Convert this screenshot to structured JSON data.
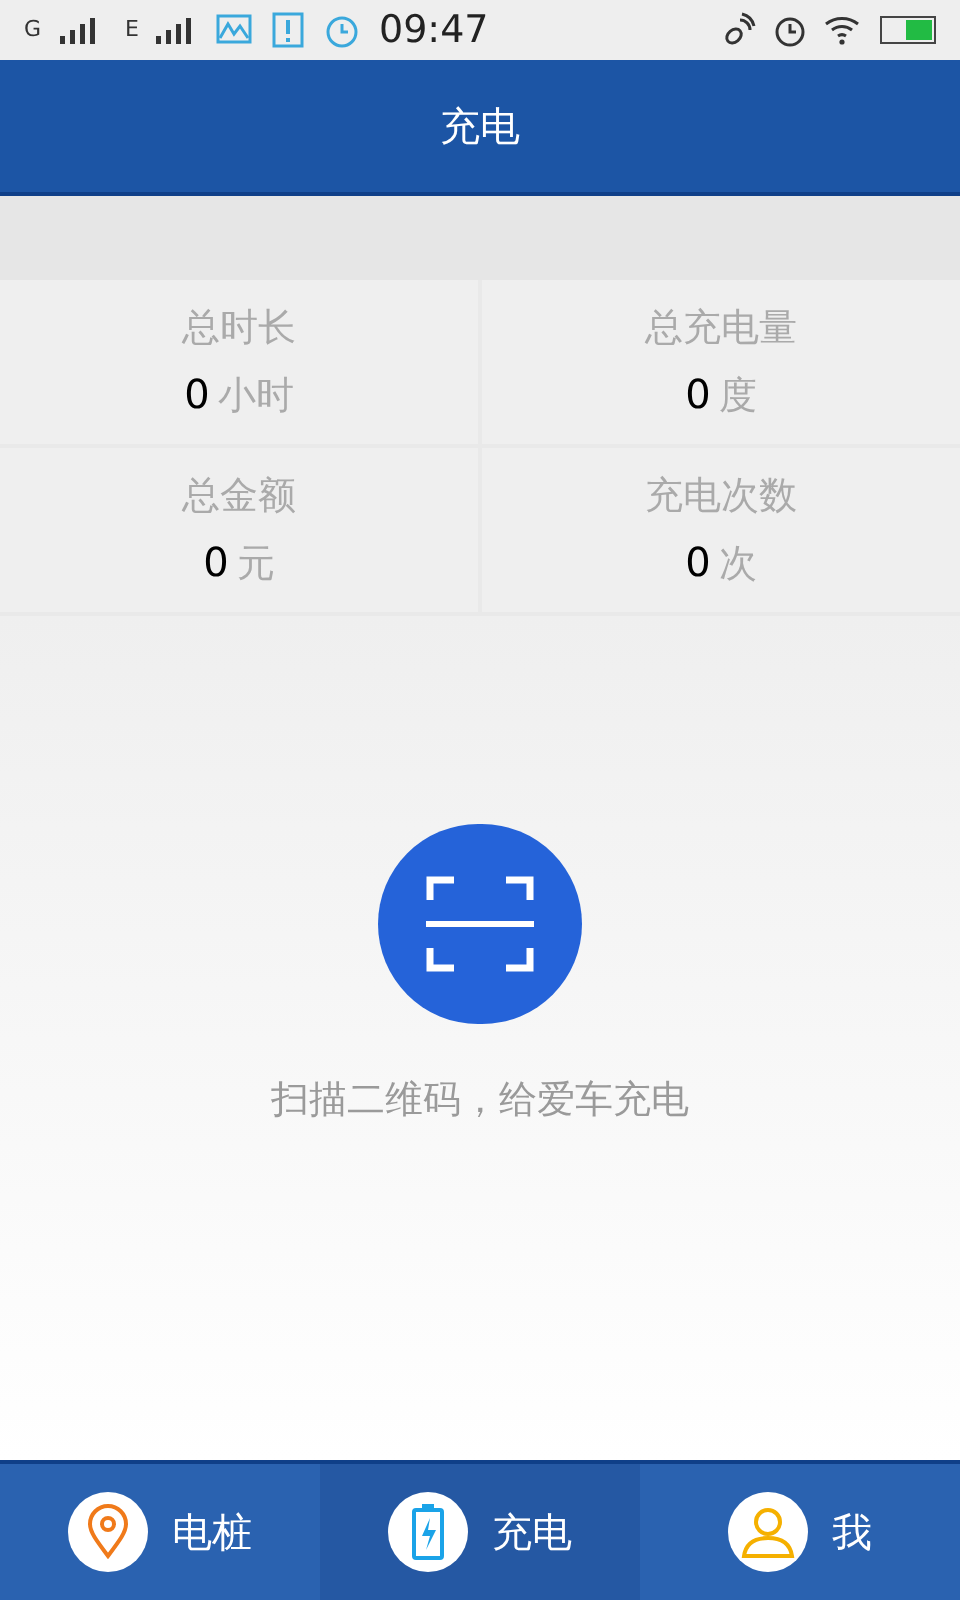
{
  "status_bar": {
    "sim1": "G",
    "sim2": "E",
    "time": "09:47"
  },
  "header": {
    "title": "充电"
  },
  "stats": [
    {
      "label": "总时长",
      "value": "0",
      "unit": "小时"
    },
    {
      "label": "总充电量",
      "value": "0",
      "unit": "度"
    },
    {
      "label": "总金额",
      "value": "0",
      "unit": "元"
    },
    {
      "label": "充电次数",
      "value": "0",
      "unit": "次"
    }
  ],
  "scan": {
    "caption": "扫描二维码，给爱车充电"
  },
  "tabs": [
    {
      "kind": "pin",
      "label": "电桩",
      "selected": false
    },
    {
      "kind": "battery",
      "label": "充电",
      "selected": true
    },
    {
      "kind": "user",
      "label": "我",
      "selected": false
    }
  ]
}
